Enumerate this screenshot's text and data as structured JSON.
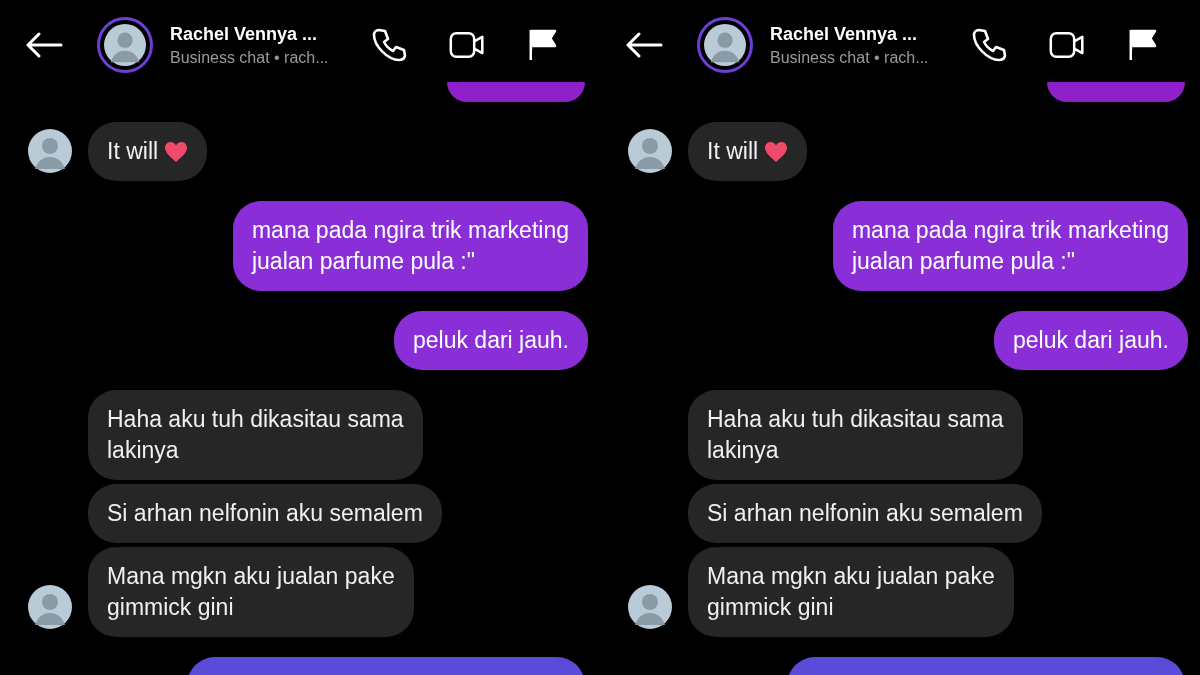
{
  "panels": [
    {
      "header": {
        "name": "Rachel Vennya ...",
        "subtitle": "Business chat • rach..."
      },
      "messages": [
        {
          "kind": "received",
          "text": "It will",
          "heart": true,
          "avatar": true
        },
        {
          "kind": "sent",
          "text": "mana pada ngira trik marketing\njualan parfume pula :\""
        },
        {
          "kind": "sent",
          "text": "peluk dari jauh."
        },
        {
          "kind": "received",
          "text": "Haha aku tuh dikasitau sama\nlakinya",
          "heart": false,
          "avatar": false
        },
        {
          "kind": "received",
          "text": "Si arhan nelfonin aku semalem",
          "heart": false,
          "avatar": false
        },
        {
          "kind": "received",
          "text": "Mana mgkn aku jualan pake\ngimmick gini",
          "heart": false,
          "avatar": true
        }
      ]
    },
    {
      "header": {
        "name": "Rachel Vennya ...",
        "subtitle": "Business chat • rach..."
      },
      "messages": [
        {
          "kind": "received",
          "text": "It will",
          "heart": true,
          "avatar": true
        },
        {
          "kind": "sent",
          "text": "mana pada ngira trik marketing\njualan parfume pula :\""
        },
        {
          "kind": "sent",
          "text": "peluk dari jauh."
        },
        {
          "kind": "received",
          "text": "Haha aku tuh dikasitau sama\nlakinya",
          "heart": false,
          "avatar": false
        },
        {
          "kind": "received",
          "text": "Si arhan nelfonin aku semalem",
          "heart": false,
          "avatar": false
        },
        {
          "kind": "received",
          "text": "Mana mgkn aku jualan pake\ngimmick gini",
          "heart": false,
          "avatar": true
        }
      ]
    }
  ]
}
